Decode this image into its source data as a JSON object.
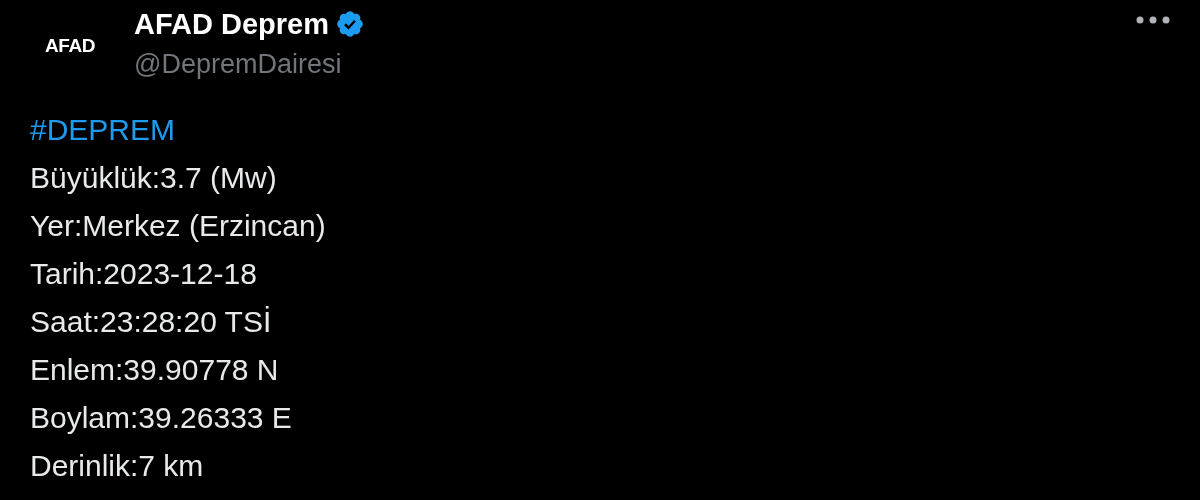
{
  "author": {
    "avatar_text": "AFAD",
    "name": "AFAD Deprem",
    "verified": true,
    "handle": "@DepremDairesi"
  },
  "hashtag": "#DEPREM",
  "lines": [
    "Büyüklük:3.7 (Mw)",
    "Yer:Merkez (Erzincan)",
    "Tarih:2023-12-18",
    "Saat:23:28:20 TSİ",
    "Enlem:39.90778 N",
    "Boylam:39.26333 E",
    "Derinlik:7 km"
  ]
}
